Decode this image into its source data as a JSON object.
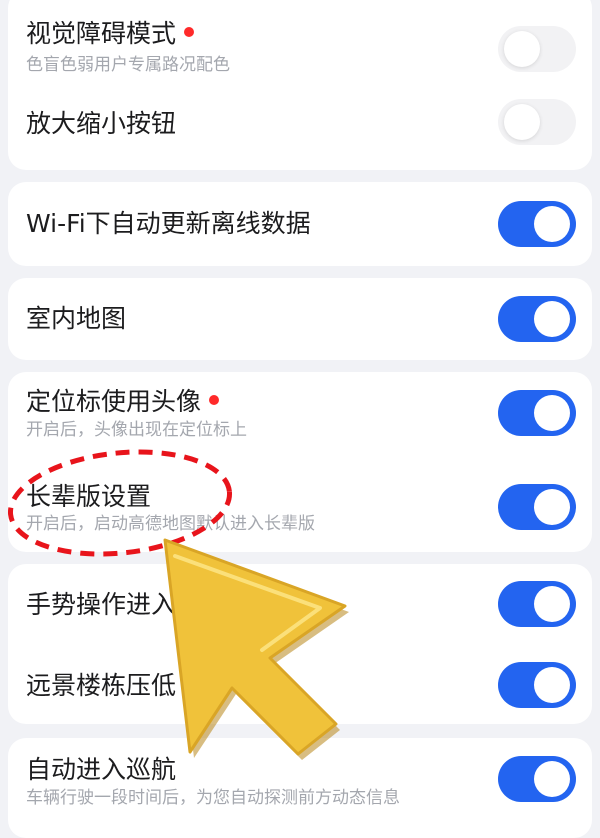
{
  "settings": [
    {
      "title": "视觉障碍模式",
      "subtitle": "色盲色弱用户专属路况配色",
      "badge": true,
      "enabled": false
    },
    {
      "title": "放大缩小按钮",
      "subtitle": "",
      "badge": false,
      "enabled": false
    },
    {
      "title": "Wi-Fi下自动更新离线数据",
      "subtitle": "",
      "badge": false,
      "enabled": true
    },
    {
      "title": "室内地图",
      "subtitle": "",
      "badge": false,
      "enabled": true
    },
    {
      "title": "定位标使用头像",
      "subtitle": "开启后，头像出现在定位标上",
      "badge": true,
      "enabled": true
    },
    {
      "title": "长辈版设置",
      "subtitle": "开启后，启动高德地图默认进入长辈版",
      "badge": false,
      "enabled": true
    },
    {
      "title": "手势操作进入",
      "subtitle": "",
      "badge": false,
      "enabled": true
    },
    {
      "title": "远景楼栋压低",
      "subtitle": "",
      "badge": false,
      "enabled": true
    },
    {
      "title": "自动进入巡航",
      "subtitle": "车辆行驶一段时间后，为您自动探测前方动态信息",
      "badge": false,
      "enabled": true
    }
  ],
  "colors": {
    "toggle_on": "#2364f0",
    "toggle_off": "#f2f2f4",
    "badge": "#ff2a2a",
    "annotation_circle": "#e8141b",
    "cursor": "#f0c23a"
  },
  "icons": {
    "annotation": "red-dashed-ellipse",
    "pointer": "yellow-arrow-cursor-icon"
  }
}
